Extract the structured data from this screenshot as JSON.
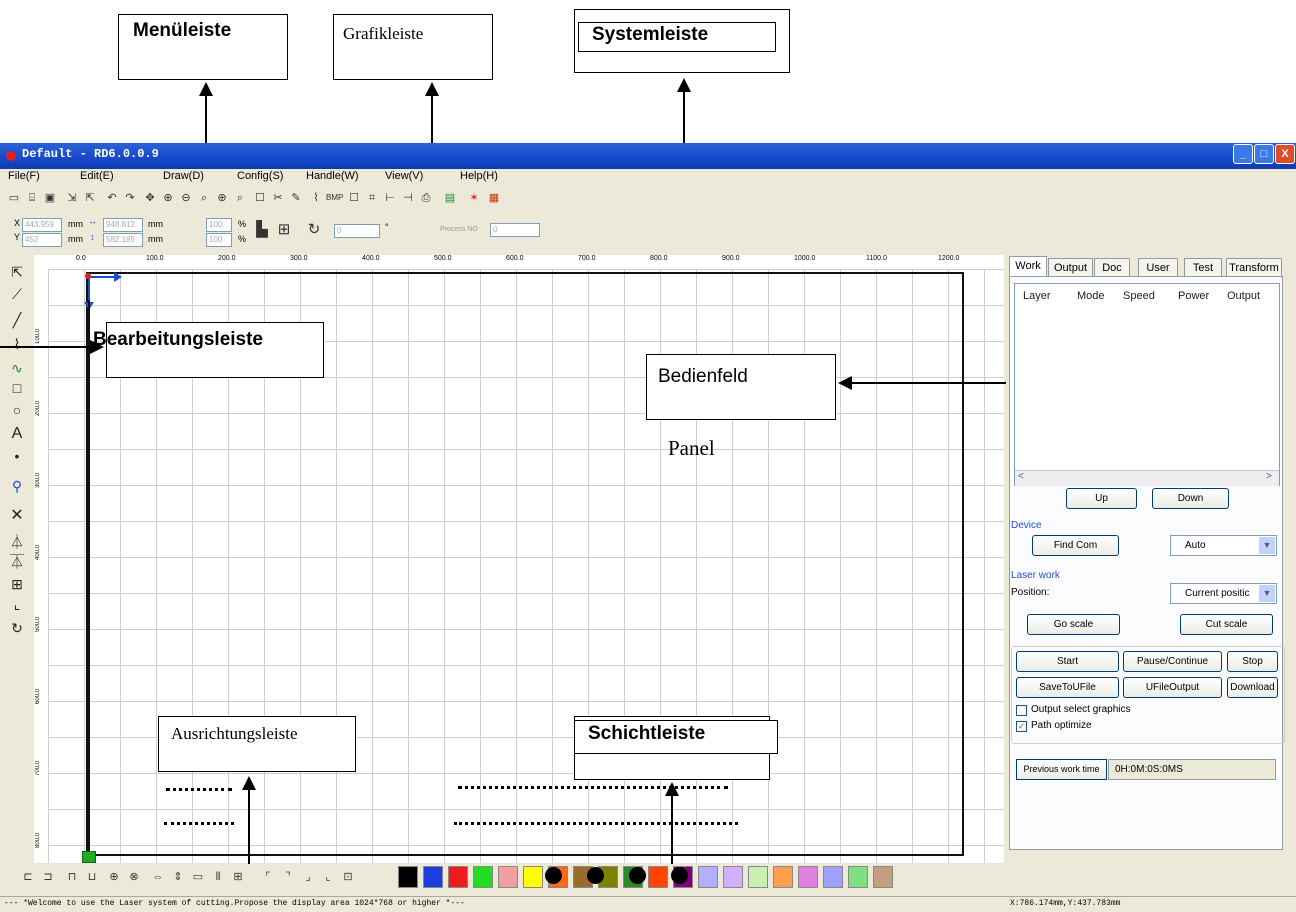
{
  "annotations": {
    "menueleiste": "Menüleiste",
    "grafikleiste": "Grafikleiste",
    "systemleiste": "Systemleiste",
    "bearbeitungsleiste": "Bearbeitungsleiste",
    "bedienfeld": "Bedienfeld",
    "panel": "Panel",
    "ausrichtungsleiste": "Ausrichtungsleiste",
    "schichtleiste": "Schichtleiste"
  },
  "window": {
    "title": "Default - RD6.0.0.9",
    "minimize": "_",
    "maximize": "□",
    "close": "X"
  },
  "menu": [
    {
      "label": "File(F)",
      "name": "menu-file"
    },
    {
      "label": "Edit(E)",
      "name": "menu-edit"
    },
    {
      "label": "Draw(D)",
      "name": "menu-draw"
    },
    {
      "label": "Config(S)",
      "name": "menu-config"
    },
    {
      "label": "Handle(W)",
      "name": "menu-handle"
    },
    {
      "label": "View(V)",
      "name": "menu-view"
    },
    {
      "label": "Help(H)",
      "name": "menu-help"
    }
  ],
  "toolbar2": {
    "x_label": "X",
    "y_label": "Y",
    "x_value": "443.959",
    "y_value": "452",
    "w_value": "948.812",
    "h_value": "582.185",
    "unit": "mm",
    "scale_w": "100",
    "scale_h": "100",
    "percent": "%",
    "rotate_value": "0",
    "degree": "°",
    "process_label": "Process NO",
    "process_value": "0"
  },
  "ruler": {
    "top_ticks": [
      "0.0",
      "100.0",
      "200.0",
      "300.0",
      "400.0",
      "500.0",
      "600.0",
      "700.0",
      "800.0",
      "900.0",
      "1000.0",
      "1100.0",
      "1200.0"
    ],
    "left_ticks": [
      "100.0",
      "200.0",
      "300.0",
      "400.0",
      "500.0",
      "600.0",
      "700.0",
      "800.0"
    ]
  },
  "panel": {
    "tabs": [
      "Work",
      "Output",
      "Doc",
      "User",
      "Test",
      "Transform"
    ],
    "columns": [
      "Layer",
      "Mode",
      "Speed",
      "Power",
      "Output"
    ],
    "up": "Up",
    "down": "Down",
    "device_label": "Device",
    "find_com": "Find Com",
    "device_combo": "Auto",
    "laser_work_label": "Laser work",
    "position_label": "Position:",
    "position_combo": "Current positic",
    "go_scale": "Go scale",
    "cut_scale": "Cut scale",
    "start": "Start",
    "pause": "Pause/Continue",
    "stop": "Stop",
    "save_to_ufile": "SaveToUFile",
    "ufile_output": "UFileOutput",
    "download": "Download",
    "output_select": "Output select graphics",
    "path_optimize": "Path optimize",
    "prev_work_time": "Previous work time",
    "work_time_value": "0H:0M:0S:0MS"
  },
  "status": {
    "message": "--- *Welcome to use the Laser system of cutting.Propose the display area 1024*768 or higher *---",
    "coords": "X:786.174mm,Y:437.783mm"
  },
  "colors": {
    "titlebar": "#1748c8",
    "layer_swatches": [
      "#000000",
      "#1c3fe0",
      "#ee1c1c",
      "#22dd22",
      "#f0a0a0",
      "#ffff00",
      "#ff6a1a",
      "#9b6a2e",
      "#7f7f00",
      "#2a8a2a",
      "#ff4500",
      "#800080",
      "#b0b0ff",
      "#d0b0ff",
      "#c8f0b0",
      "#ffa050",
      "#e080e0",
      "#a0a0ff",
      "#80e080",
      "#c0a080"
    ]
  },
  "icons": [
    "select-icon",
    "node-edit-icon",
    "line-icon",
    "polyline-icon",
    "curve-icon",
    "rectangle-icon",
    "ellipse-icon",
    "text-icon",
    "point-icon",
    "bitmap-icon",
    "delete-icon",
    "mirror-h-icon",
    "mirror-v-icon",
    "array-icon",
    "set-origin-icon",
    "rotate-icon"
  ]
}
